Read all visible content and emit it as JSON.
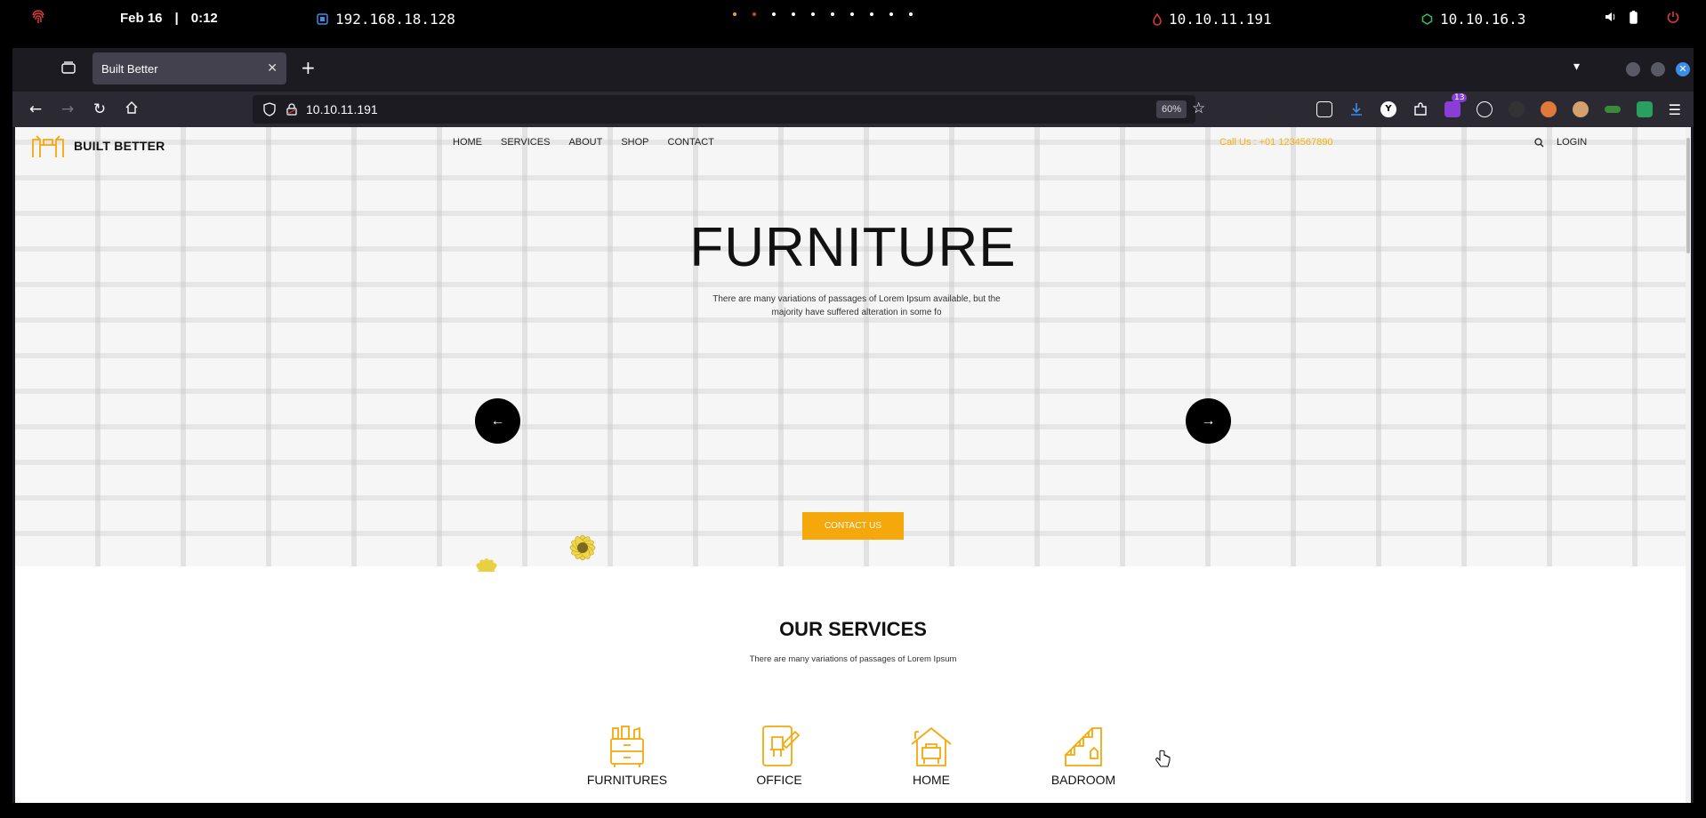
{
  "os_bar": {
    "date": "Feb 16",
    "time": "0:12",
    "vm_ip": "192.168.18.128",
    "target_ip": "10.10.11.191",
    "vpn_ip": "10.10.16.3"
  },
  "browser": {
    "tab_title": "Built Better",
    "url": "10.10.11.191",
    "zoom": "60%",
    "extension_badge": "13"
  },
  "site": {
    "brand": "BUILT BETTER",
    "nav": [
      "HOME",
      "SERVICES",
      "ABOUT",
      "SHOP",
      "CONTACT"
    ],
    "phone": "Call Us : +01 1234567890",
    "login": "LOGIN",
    "hero": {
      "title": "FURNITURE",
      "description": "There are many variations of passages of Lorem Ipsum available, but the majority have suffered alteration in some fo",
      "prev": "←",
      "next": "→",
      "cta": "CONTACT US"
    },
    "services": {
      "title": "OUR SERVICES",
      "subtitle": "There are many variations of passages of Lorem Ipsum",
      "items": [
        {
          "label": "FURNITURES",
          "icon": "cabinet-icon"
        },
        {
          "label": "OFFICE",
          "icon": "office-chair-icon"
        },
        {
          "label": "HOME",
          "icon": "house-icon"
        },
        {
          "label": "BADROOM",
          "icon": "stairs-icon"
        }
      ]
    },
    "accent_color": "#f5a80b"
  }
}
